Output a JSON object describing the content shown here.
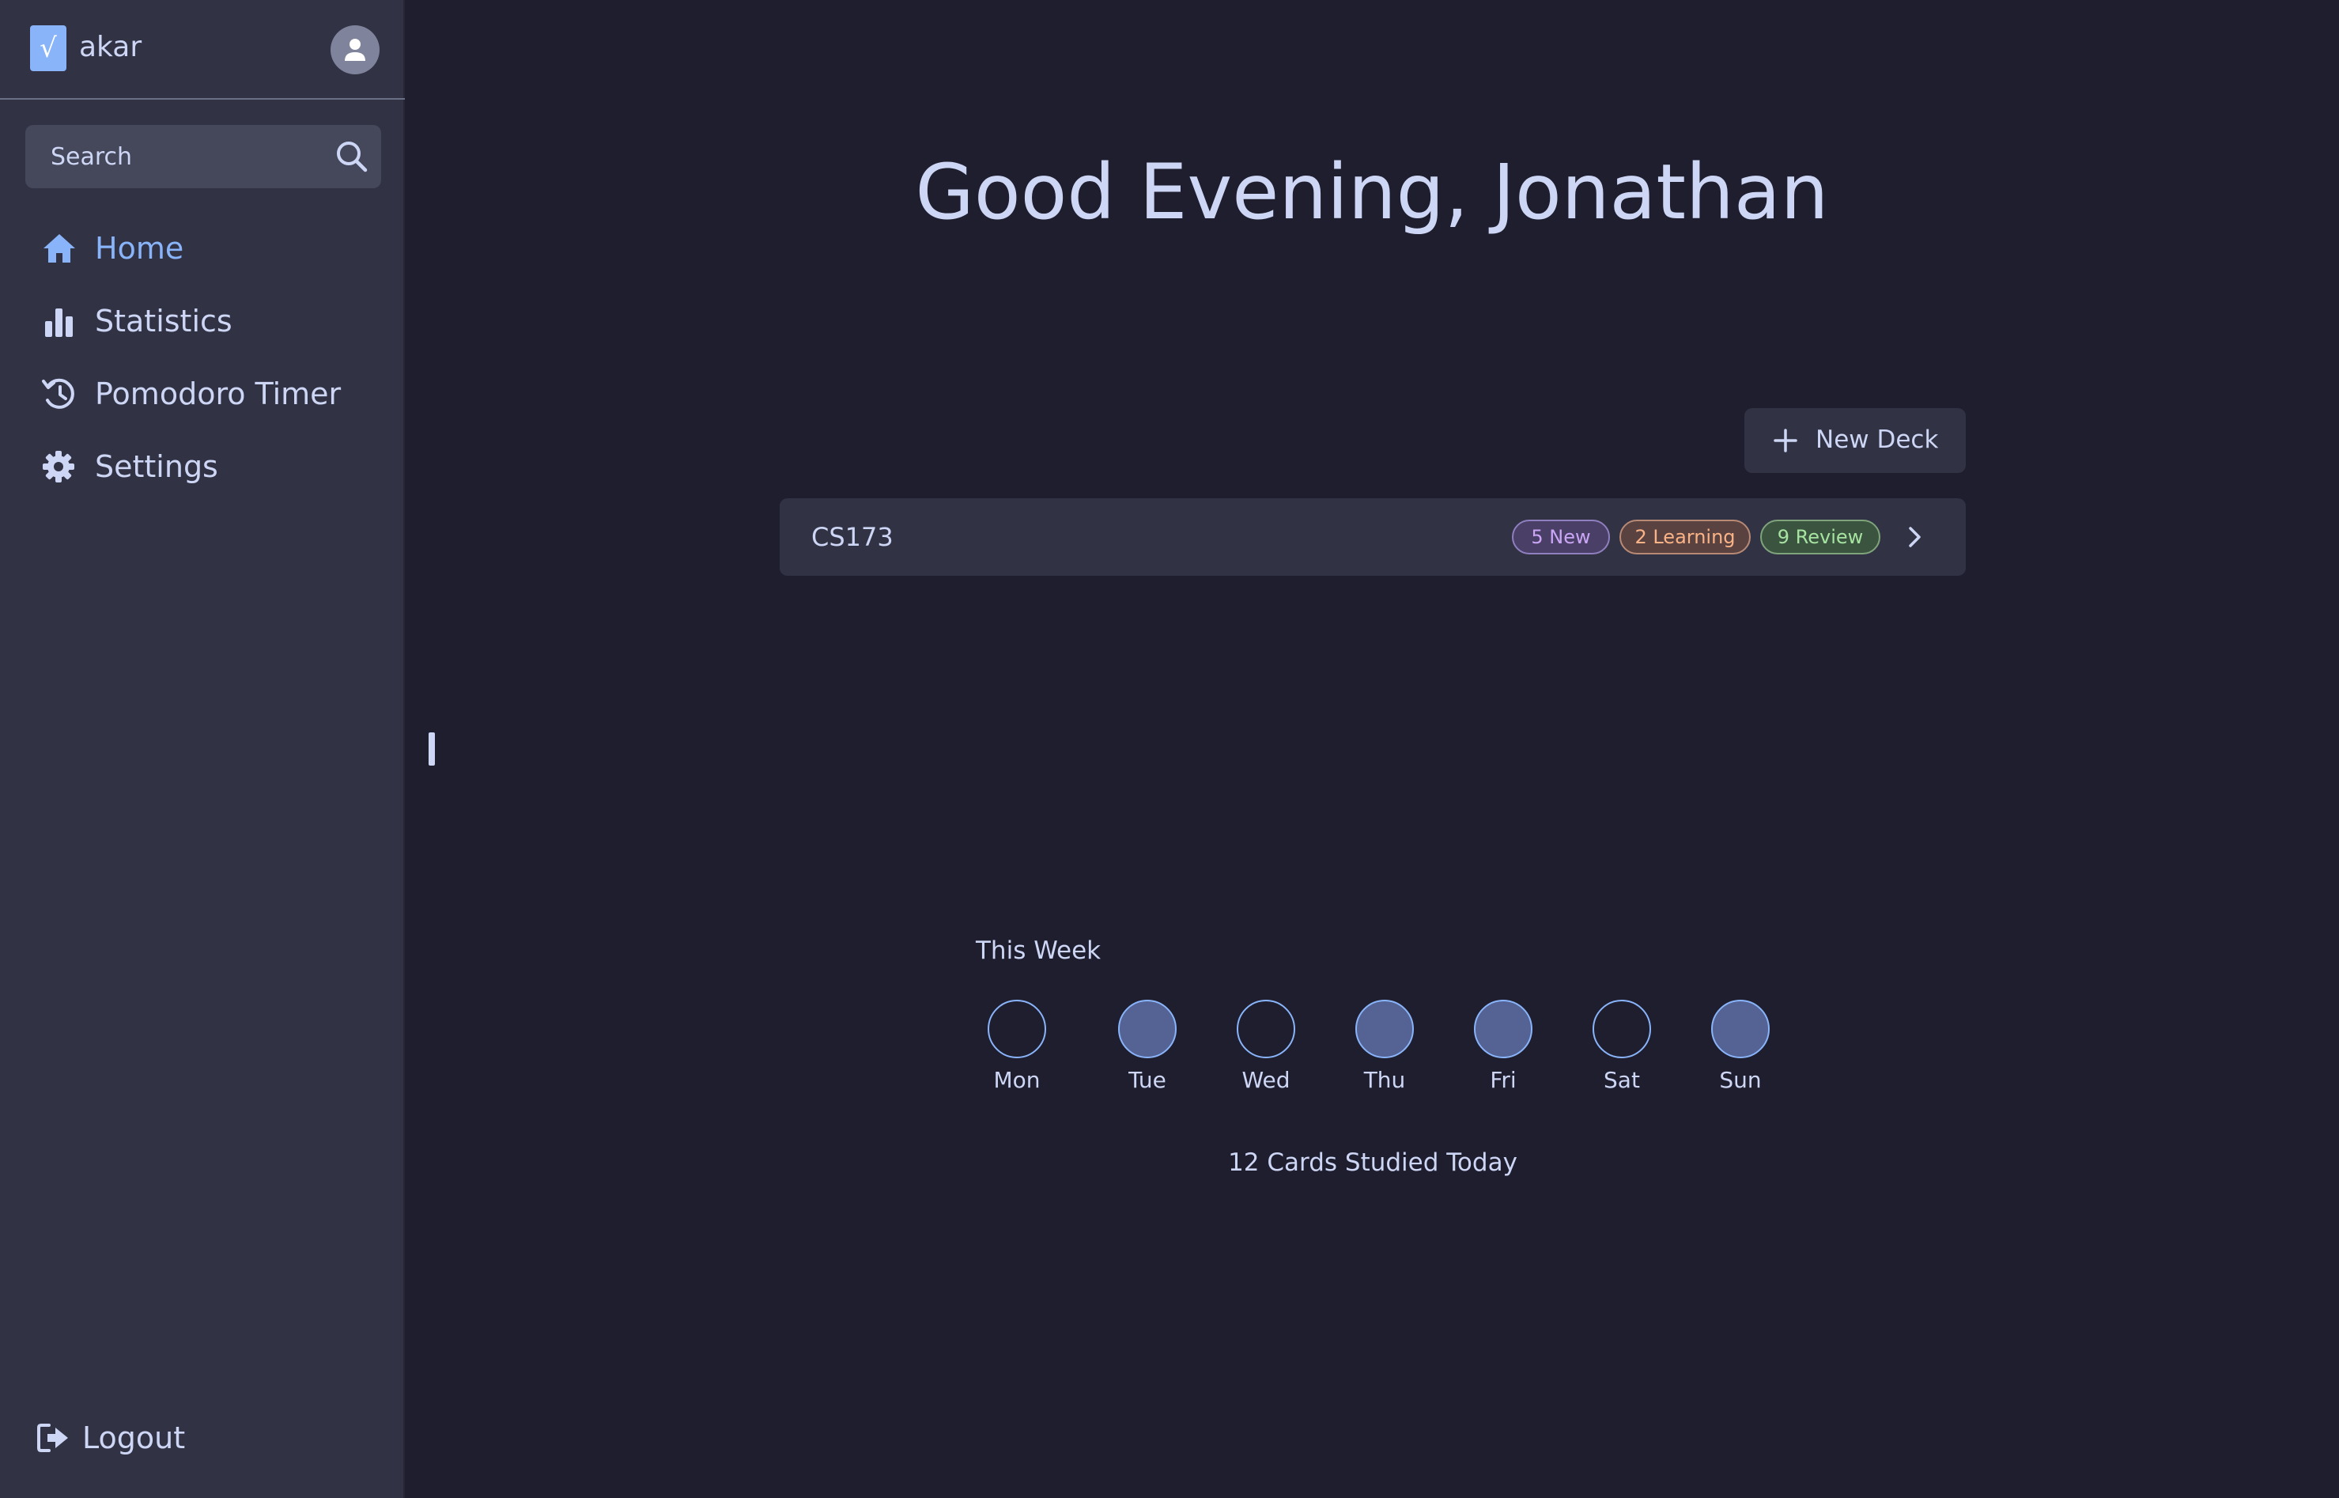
{
  "sidebar": {
    "brand": "akar",
    "logo_glyph": "√",
    "search_placeholder": "Search",
    "nav": [
      {
        "label": "Home",
        "icon": "home-icon",
        "active": true
      },
      {
        "label": "Statistics",
        "icon": "bar-chart-icon",
        "active": false
      },
      {
        "label": "Pomodoro Timer",
        "icon": "history-icon",
        "active": false
      },
      {
        "label": "Settings",
        "icon": "gear-icon",
        "active": false
      }
    ],
    "logout_label": "Logout"
  },
  "main": {
    "greeting": "Good Evening, Jonathan",
    "new_deck_label": "New Deck",
    "decks": [
      {
        "name": "CS173",
        "new_badge": "5 New",
        "learning_badge": "2 Learning",
        "review_badge": "9 Review"
      }
    ],
    "week": {
      "title": "This Week",
      "days": [
        {
          "label": "Mon",
          "studied": false
        },
        {
          "label": "Tue",
          "studied": true
        },
        {
          "label": "Wed",
          "studied": false
        },
        {
          "label": "Thu",
          "studied": true
        },
        {
          "label": "Fri",
          "studied": true
        },
        {
          "label": "Sat",
          "studied": false
        },
        {
          "label": "Sun",
          "studied": true
        }
      ],
      "studied_today": "12 Cards Studied Today"
    }
  },
  "colors": {
    "background": "#1e1e2e",
    "sidebar": "#313244",
    "accent": "#89b4fa",
    "text": "#cdd6f4",
    "badge_new": "#cba6f7",
    "badge_learning": "#fab387",
    "badge_review": "#a6e3a1"
  }
}
